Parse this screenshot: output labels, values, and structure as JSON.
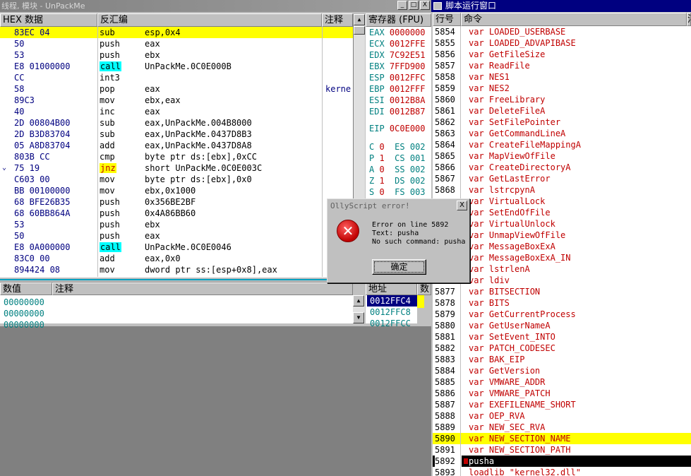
{
  "cpu_window": {
    "title": "线程, 模块 - UnPackMe",
    "btn_min": "_",
    "btn_max": "□",
    "btn_close": "X",
    "col_hex": "HEX 数据",
    "col_disasm": "反汇编",
    "col_comment": "注释",
    "col_regs": "寄存器 (FPU)",
    "rows": [
      {
        "hex": "83EC 04",
        "op": "sub",
        "args": "esp,0x4",
        "cmt": "",
        "mark": ""
      },
      {
        "hex": "50",
        "op": "push",
        "args": "eax",
        "cmt": "",
        "mark": ""
      },
      {
        "hex": "53",
        "op": "push",
        "args": "ebx",
        "cmt": "",
        "mark": ""
      },
      {
        "hex": "E8 01000000",
        "op": "call",
        "args": "UnPackMe.0C0E000B",
        "cmt": "",
        "mark": ""
      },
      {
        "hex": "CC",
        "op": "int3",
        "args": "",
        "cmt": "",
        "mark": ""
      },
      {
        "hex": "58",
        "op": "pop",
        "args": "eax",
        "cmt": "kerne",
        "mark": ""
      },
      {
        "hex": "89C3",
        "op": "mov",
        "args": "ebx,eax",
        "cmt": "",
        "mark": ""
      },
      {
        "hex": "40",
        "op": "inc",
        "args": "eax",
        "cmt": "",
        "mark": ""
      },
      {
        "hex": "2D 00804B00",
        "op": "sub",
        "args": "eax,UnPackMe.004B8000",
        "cmt": "",
        "mark": ""
      },
      {
        "hex": "2D B3D83704",
        "op": "sub",
        "args": "eax,UnPackMe.0437D8B3",
        "cmt": "",
        "mark": ""
      },
      {
        "hex": "05 A8D83704",
        "op": "add",
        "args": "eax,UnPackMe.0437D8A8",
        "cmt": "",
        "mark": ""
      },
      {
        "hex": "803B CC",
        "op": "cmp",
        "args": "byte ptr ds:[ebx],0xCC",
        "cmt": "",
        "mark": ""
      },
      {
        "hex": "75 19",
        "op": "jnz",
        "args": "short UnPackMe.0C0E003C",
        "cmt": "",
        "mark": "⌄"
      },
      {
        "hex": "C603 00",
        "op": "mov",
        "args": "byte ptr ds:[ebx],0x0",
        "cmt": "",
        "mark": ""
      },
      {
        "hex": "BB 00100000",
        "op": "mov",
        "args": "ebx,0x1000",
        "cmt": "",
        "mark": ""
      },
      {
        "hex": "68 BFE26B35",
        "op": "push",
        "args": "0x356BE2BF",
        "cmt": "",
        "mark": ""
      },
      {
        "hex": "68 60BB864A",
        "op": "push",
        "args": "0x4A86BB60",
        "cmt": "",
        "mark": ""
      },
      {
        "hex": "53",
        "op": "push",
        "args": "ebx",
        "cmt": "",
        "mark": ""
      },
      {
        "hex": "50",
        "op": "push",
        "args": "eax",
        "cmt": "",
        "mark": ""
      },
      {
        "hex": "E8 0A000000",
        "op": "call",
        "args": "UnPackMe.0C0E0046",
        "cmt": "",
        "mark": ""
      },
      {
        "hex": "83C0 00",
        "op": "add",
        "args": "eax,0x0",
        "cmt": "",
        "mark": ""
      },
      {
        "hex": "894424 08",
        "op": "mov",
        "args": "dword ptr ss:[esp+0x8],eax",
        "cmt": "",
        "mark": ""
      }
    ],
    "registers": [
      {
        "name": "EAX",
        "value": "0000000"
      },
      {
        "name": "ECX",
        "value": "0012FFE"
      },
      {
        "name": "EDX",
        "value": "7C92E51"
      },
      {
        "name": "EBX",
        "value": "7FFD900"
      },
      {
        "name": "ESP",
        "value": "0012FFC"
      },
      {
        "name": "EBP",
        "value": "0012FFF"
      },
      {
        "name": "ESI",
        "value": "0012B8A"
      },
      {
        "name": "EDI",
        "value": "0012B87"
      },
      {
        "name": "EIP",
        "value": "0C0E000"
      }
    ],
    "flags": [
      {
        "flag": "C",
        "fv": "0",
        "seg": "ES",
        "sv": "002"
      },
      {
        "flag": "P",
        "fv": "1",
        "seg": "CS",
        "sv": "001"
      },
      {
        "flag": "A",
        "fv": "0",
        "seg": "SS",
        "sv": "002"
      },
      {
        "flag": "Z",
        "fv": "1",
        "seg": "DS",
        "sv": "002"
      },
      {
        "flag": "S",
        "fv": "0",
        "seg": "FS",
        "sv": "003"
      }
    ],
    "dump_col_value": "数值",
    "dump_col_comment": "注释",
    "dump_rows": [
      "00000000",
      "00000000",
      "00000000"
    ],
    "stack_col_addr": "地址",
    "stack_col_val": "数",
    "stack_rows": [
      "0012FFC4",
      "0012FFC8",
      "0012FFCC"
    ]
  },
  "script_window": {
    "title": "脚本运行窗口",
    "col_line": "行号",
    "col_cmd": "命令",
    "col_more": "注",
    "rows": [
      {
        "ln": "5854",
        "cmd": "var LOADED_USERBASE"
      },
      {
        "ln": "5855",
        "cmd": "var LOADED_ADVAPIBASE"
      },
      {
        "ln": "5856",
        "cmd": "var GetFileSize"
      },
      {
        "ln": "5857",
        "cmd": "var ReadFile"
      },
      {
        "ln": "5858",
        "cmd": "var NES1"
      },
      {
        "ln": "5859",
        "cmd": "var NES2"
      },
      {
        "ln": "5860",
        "cmd": "var FreeLibrary"
      },
      {
        "ln": "5861",
        "cmd": "var DeleteFileA"
      },
      {
        "ln": "5862",
        "cmd": "var SetFilePointer"
      },
      {
        "ln": "5863",
        "cmd": "var GetCommandLineA"
      },
      {
        "ln": "5864",
        "cmd": "var CreateFileMappingA"
      },
      {
        "ln": "5865",
        "cmd": "var MapViewOfFile"
      },
      {
        "ln": "5866",
        "cmd": "var CreateDirectoryA"
      },
      {
        "ln": "5867",
        "cmd": "var GetLastError"
      },
      {
        "ln": "5868",
        "cmd": "var lstrcpynA"
      },
      {
        "ln": "",
        "cmd": "var VirtualLock"
      },
      {
        "ln": "",
        "cmd": "var SetEndOfFile"
      },
      {
        "ln": "",
        "cmd": "var VirtualUnlock"
      },
      {
        "ln": "",
        "cmd": "var UnmapViewOfFile"
      },
      {
        "ln": "",
        "cmd": "var MessageBoxExA"
      },
      {
        "ln": "",
        "cmd": "var MessageBoxExA_IN"
      },
      {
        "ln": "",
        "cmd": "var lstrlenA"
      },
      {
        "ln": "",
        "cmd": "var ldiv"
      },
      {
        "ln": "5877",
        "cmd": "var BITSECTION"
      },
      {
        "ln": "5878",
        "cmd": "var BITS"
      },
      {
        "ln": "5879",
        "cmd": "var GetCurrentProcess"
      },
      {
        "ln": "5880",
        "cmd": "var GetUserNameA"
      },
      {
        "ln": "5881",
        "cmd": "var SetEvent_INTO"
      },
      {
        "ln": "5882",
        "cmd": "var PATCH_CODESEC"
      },
      {
        "ln": "5883",
        "cmd": "var BAK_EIP"
      },
      {
        "ln": "5884",
        "cmd": "var GetVersion"
      },
      {
        "ln": "5885",
        "cmd": "var VMWARE_ADDR"
      },
      {
        "ln": "5886",
        "cmd": "var VMWARE_PATCH"
      },
      {
        "ln": "5887",
        "cmd": "var EXEFILENAME_SHORT"
      },
      {
        "ln": "5888",
        "cmd": "var OEP_RVA"
      },
      {
        "ln": "5889",
        "cmd": "var NEW_SEC_RVA"
      },
      {
        "ln": "5890",
        "cmd": "var NEW_SECTION_NAME"
      },
      {
        "ln": "5891",
        "cmd": "var NEW_SECTION_PATH"
      },
      {
        "ln": "5892",
        "cmd": "pusha"
      },
      {
        "ln": "5893",
        "cmd": "loadlib \"kernel32.dll\""
      }
    ]
  },
  "dialog": {
    "title": "OllyScript error!",
    "close": "X",
    "line1": "Error on line 5892",
    "line2": "Text: pusha",
    "line3": "No such command: pusha",
    "ok": "确定",
    "icon": "error-icon"
  },
  "colors": {
    "selection": "#ffff00",
    "script_title": "#000080",
    "var_red": "#c00000",
    "hex_navy": "#000080",
    "call_cyan": "#00ffff"
  }
}
